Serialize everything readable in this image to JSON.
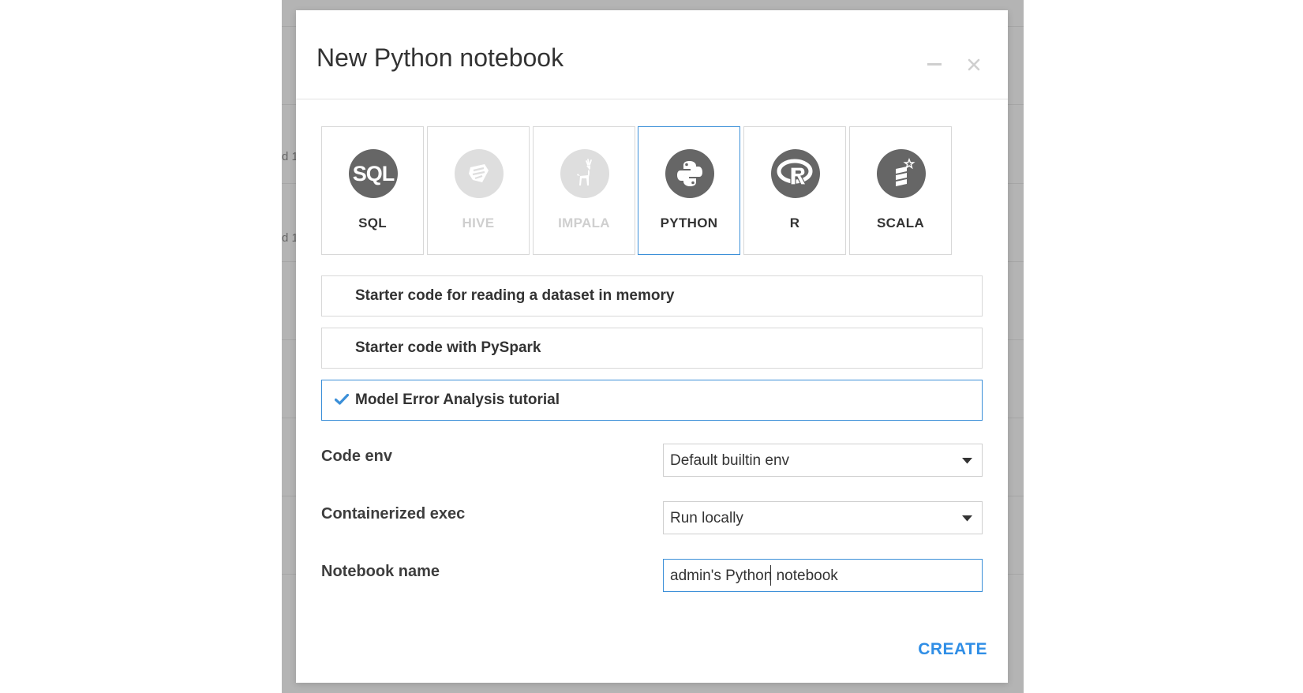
{
  "backdrop": {
    "fragments": [
      "d 1",
      "d 1"
    ]
  },
  "dialog": {
    "title": "New Python notebook"
  },
  "languages": [
    {
      "label": "SQL",
      "icon": "sql-icon",
      "state": "enabled"
    },
    {
      "label": "HIVE",
      "icon": "hive-icon",
      "state": "disabled"
    },
    {
      "label": "IMPALA",
      "icon": "impala-icon",
      "state": "disabled"
    },
    {
      "label": "PYTHON",
      "icon": "python-icon",
      "state": "selected"
    },
    {
      "label": "R",
      "icon": "r-icon",
      "state": "enabled"
    },
    {
      "label": "SCALA",
      "icon": "scala-icon",
      "state": "enabled"
    }
  ],
  "sql_icon_text": "SQL",
  "templates": [
    {
      "label": "Starter code for reading a dataset in memory",
      "selected": false
    },
    {
      "label": "Starter code with PySpark",
      "selected": false
    },
    {
      "label": "Model Error Analysis tutorial",
      "selected": true
    }
  ],
  "form": {
    "code_env": {
      "label": "Code env",
      "value": "Default builtin env"
    },
    "containerized_exec": {
      "label": "Containerized exec",
      "value": "Run locally"
    },
    "notebook_name": {
      "label": "Notebook name",
      "value": "admin's Python notebook"
    }
  },
  "actions": {
    "create_label": "CREATE"
  },
  "colors": {
    "accent": "#3b8fd8",
    "create_text": "#2f8ee6",
    "icon_dark": "#666666",
    "icon_disabled": "#dedede",
    "backdrop": "#b4b4b4"
  }
}
